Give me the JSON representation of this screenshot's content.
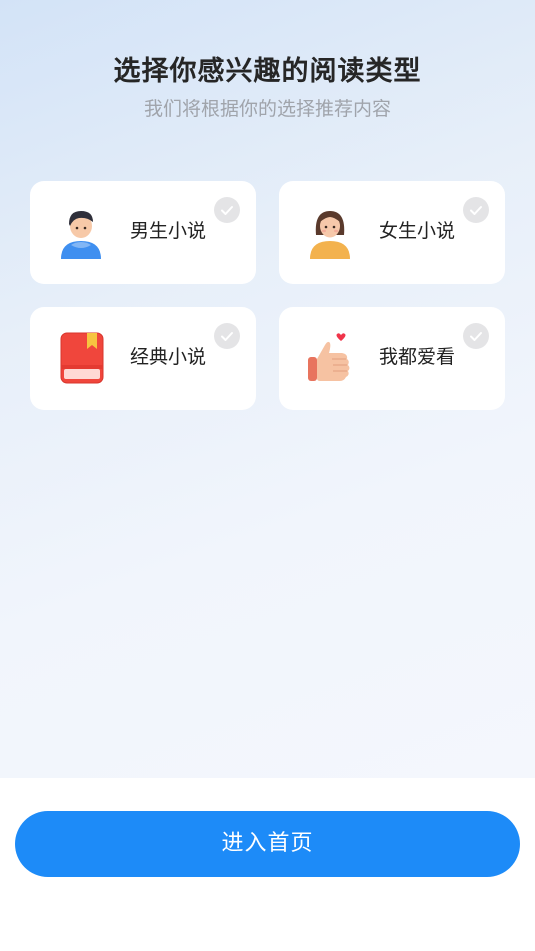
{
  "header": {
    "title": "选择你感兴趣的阅读类型",
    "subtitle": "我们将根据你的选择推荐内容"
  },
  "categories": [
    {
      "label": "男生小说",
      "icon": "male-avatar-icon",
      "selected": false
    },
    {
      "label": "女生小说",
      "icon": "female-avatar-icon",
      "selected": false
    },
    {
      "label": "经典小说",
      "icon": "book-icon",
      "selected": false
    },
    {
      "label": "我都爱看",
      "icon": "thumbs-up-heart-icon",
      "selected": false
    }
  ],
  "footer": {
    "enter_label": "进入首页"
  },
  "colors": {
    "accent": "#1d8bf8",
    "check_unselected": "#e4e4e6"
  }
}
